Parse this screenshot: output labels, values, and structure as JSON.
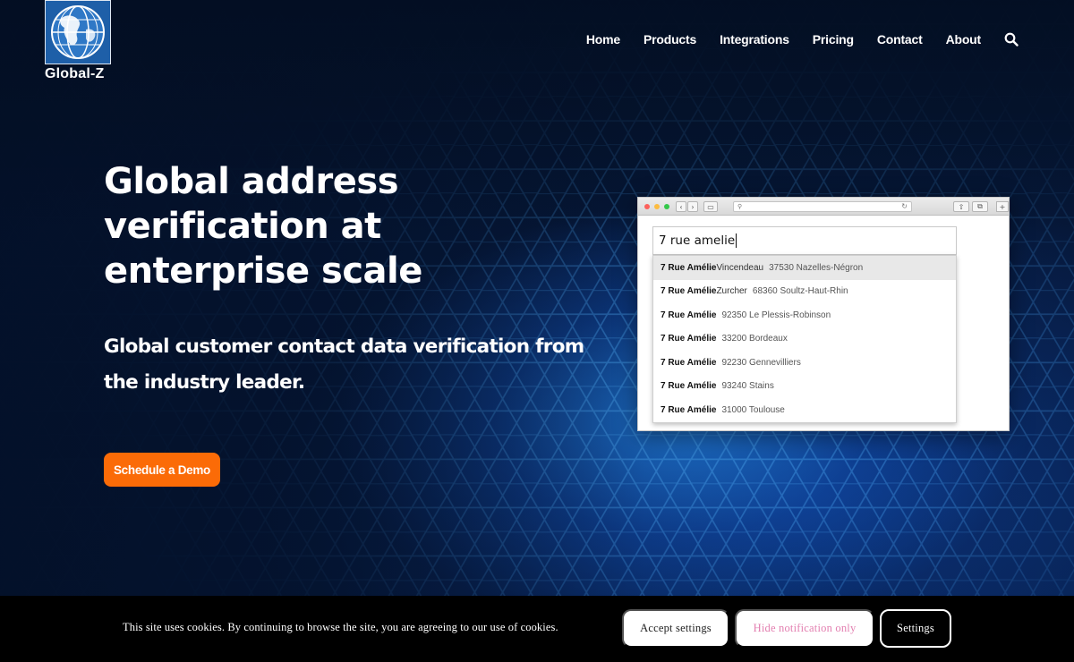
{
  "brand": {
    "name": "Global-Z",
    "colors": {
      "accent": "#fb6b07",
      "logo_blue": "#1e5fa8",
      "background": "#041633"
    }
  },
  "nav": {
    "items": [
      {
        "label": "Home"
      },
      {
        "label": "Products"
      },
      {
        "label": "Integrations"
      },
      {
        "label": "Pricing"
      },
      {
        "label": "Contact"
      },
      {
        "label": "About"
      }
    ],
    "search_icon": "search-icon"
  },
  "hero": {
    "headline_lines": [
      "Global address",
      "verification at",
      "enterprise scale"
    ],
    "subhead_lines": [
      "Global customer contact data verification from",
      "the industry leader."
    ],
    "cta_label": "Schedule a Demo"
  },
  "demo": {
    "query": "7 rue amelie",
    "suggestions": [
      {
        "street": "7 Rue Amélie",
        "suffix": " Vincendeau",
        "location": "37530 Nazelles-Négron"
      },
      {
        "street": "7 Rue Amélie",
        "suffix": " Zurcher",
        "location": "68360 Soultz-Haut-Rhin"
      },
      {
        "street": "7 Rue Amélie",
        "suffix": "",
        "location": "92350 Le Plessis-Robinson"
      },
      {
        "street": "7 Rue Amélie",
        "suffix": "",
        "location": "33200 Bordeaux"
      },
      {
        "street": "7 Rue Amélie",
        "suffix": "",
        "location": "92230 Gennevilliers"
      },
      {
        "street": "7 Rue Amélie",
        "suffix": "",
        "location": "93240 Stains"
      },
      {
        "street": "7 Rue Amélie",
        "suffix": "",
        "location": "31000 Toulouse"
      }
    ]
  },
  "cookie": {
    "message": "This site uses cookies. By continuing to browse the site, you are agreeing to our use of cookies.",
    "accept_label": "Accept settings",
    "hide_label": "Hide notification only",
    "settings_label": "Settings"
  }
}
